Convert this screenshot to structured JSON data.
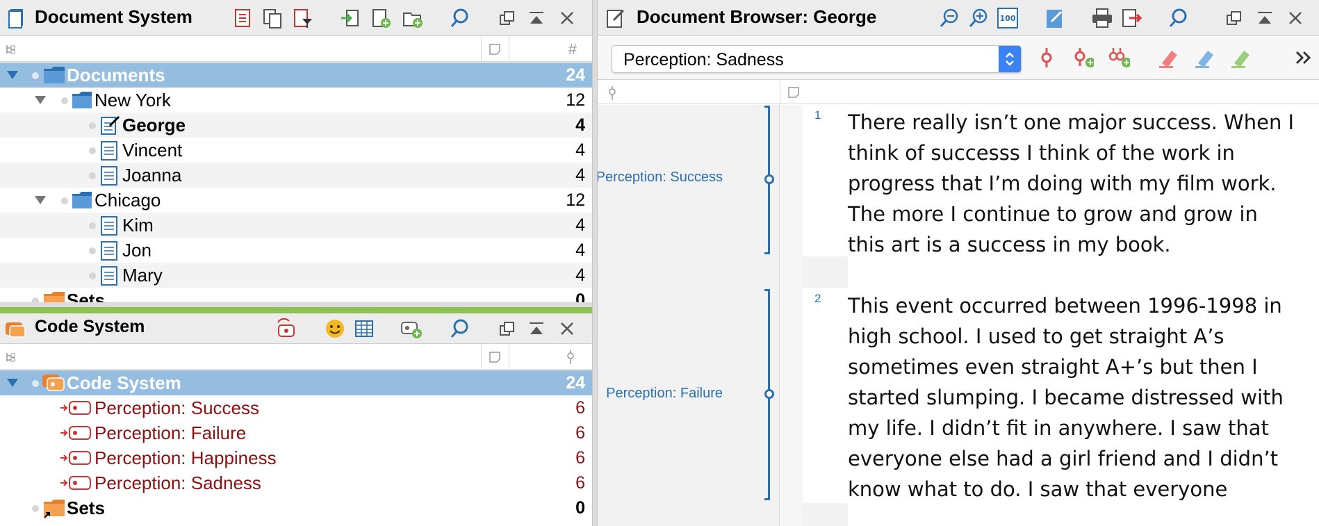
{
  "doc_system": {
    "title": "Document System",
    "rows": [
      {
        "label": "Documents",
        "count": "24"
      },
      {
        "label": "New York",
        "count": "12"
      },
      {
        "label": "George",
        "count": "4"
      },
      {
        "label": "Vincent",
        "count": "4"
      },
      {
        "label": "Joanna",
        "count": "4"
      },
      {
        "label": "Chicago",
        "count": "12"
      },
      {
        "label": "Kim",
        "count": "4"
      },
      {
        "label": "Jon",
        "count": "4"
      },
      {
        "label": "Mary",
        "count": "4"
      },
      {
        "label": "Sets",
        "count": "0"
      }
    ],
    "col_hash": "#"
  },
  "code_system": {
    "title": "Code System",
    "rows": [
      {
        "label": "Code System",
        "count": "24"
      },
      {
        "label": "Perception: Success",
        "count": "6"
      },
      {
        "label": "Perception: Failure",
        "count": "6"
      },
      {
        "label": "Perception: Happiness",
        "count": "6"
      },
      {
        "label": "Perception: Sadness",
        "count": "6"
      },
      {
        "label": "Sets",
        "count": "0"
      }
    ]
  },
  "browser": {
    "title": "Document Browser: George",
    "dropdown_value": "Perception: Sadness",
    "paragraphs": [
      {
        "num": "1",
        "code": "Perception: Success",
        "lines": [
          "There really isn’t one major success. When I",
          "think of successs I think of the work in",
          "progress that I’m doing with my film work.",
          "The more I continue to grow and grow in",
          "this art is a success in my book."
        ]
      },
      {
        "num": "2",
        "code": "Perception: Failure",
        "lines": [
          "This event occurred between 1996-1998 in",
          "high school. I used to get straight A’s",
          "sometimes even straight A+’s but then I",
          "started slumping. I became distressed with",
          "my life. I didn’t fit in anywhere. I saw that",
          "everyone else had a girl friend and I didn’t",
          "know what to do. I saw that everyone"
        ]
      }
    ]
  },
  "colors": {
    "accent_blue": "#2a6fb0",
    "selection": "#95bddf",
    "code_red": "#8a1212",
    "divider_green": "#8cc152"
  }
}
